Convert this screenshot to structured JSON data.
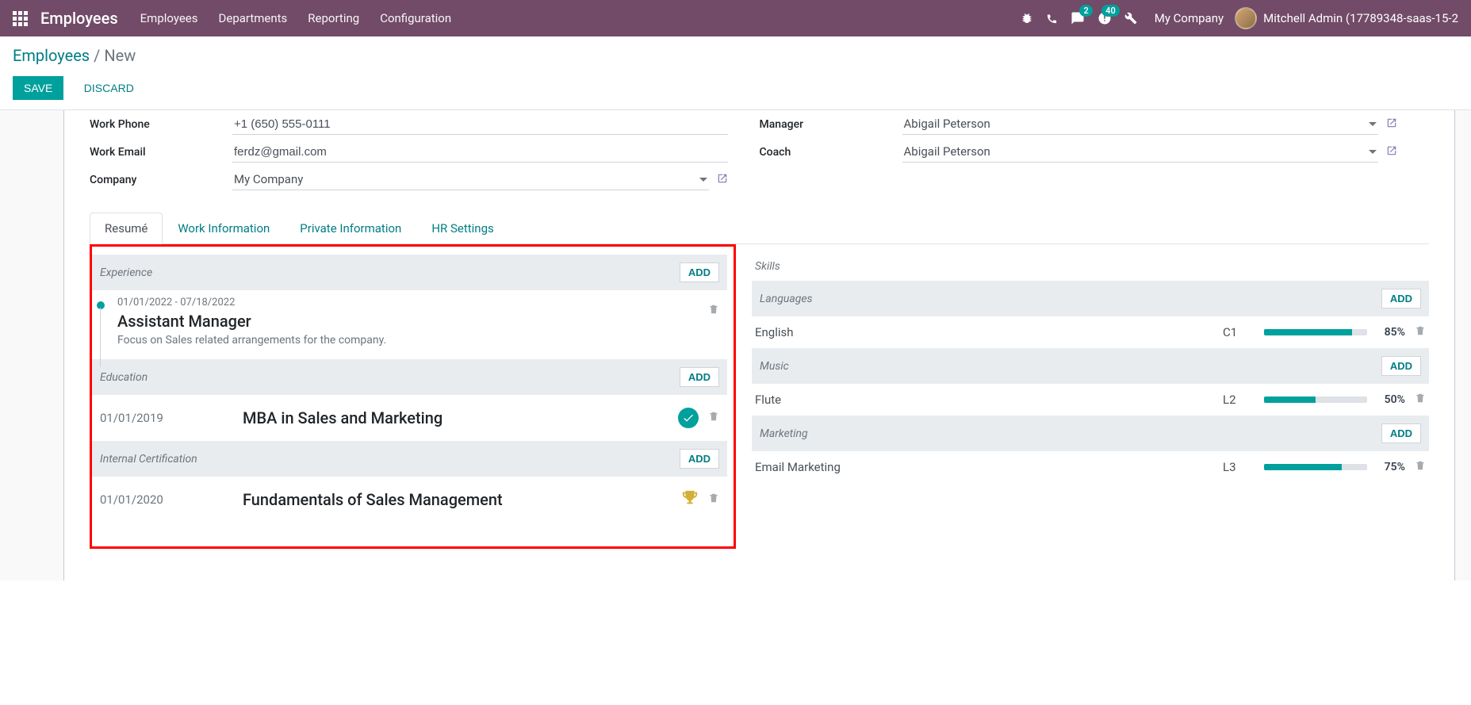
{
  "navbar": {
    "brand": "Employees",
    "links": [
      "Employees",
      "Departments",
      "Reporting",
      "Configuration"
    ],
    "messages_badge": "2",
    "activities_badge": "40",
    "company": "My Company",
    "user": "Mitchell Admin (17789348-saas-15-2"
  },
  "breadcrumb": {
    "root": "Employees",
    "current": "New"
  },
  "buttons": {
    "save": "SAVE",
    "discard": "DISCARD",
    "add": "ADD"
  },
  "form": {
    "work_phone_label": "Work Phone",
    "work_phone": "+1 (650) 555-0111",
    "work_email_label": "Work Email",
    "work_email": "ferdz@gmail.com",
    "company_label": "Company",
    "company": "My Company",
    "manager_label": "Manager",
    "manager": "Abigail Peterson",
    "coach_label": "Coach",
    "coach": "Abigail Peterson"
  },
  "tabs": [
    "Resumé",
    "Work Information",
    "Private Information",
    "HR Settings"
  ],
  "resume": {
    "experience_label": "Experience",
    "experience": {
      "dates": "01/01/2022 - 07/18/2022",
      "role": "Assistant Manager",
      "desc": "Focus on Sales related arrangements for the company."
    },
    "education_label": "Education",
    "education": {
      "date": "01/01/2019",
      "title": "MBA in Sales and Marketing"
    },
    "certification_label": "Internal Certification",
    "certification": {
      "date": "01/01/2020",
      "title": "Fundamentals of Sales Management"
    }
  },
  "skills": {
    "title": "Skills",
    "groups": [
      {
        "name": "Languages",
        "items": [
          {
            "name": "English",
            "level": "C1",
            "pct": "85%",
            "fill": 85
          }
        ]
      },
      {
        "name": "Music",
        "items": [
          {
            "name": "Flute",
            "level": "L2",
            "pct": "50%",
            "fill": 50
          }
        ]
      },
      {
        "name": "Marketing",
        "items": [
          {
            "name": "Email Marketing",
            "level": "L3",
            "pct": "75%",
            "fill": 75
          }
        ]
      }
    ]
  }
}
